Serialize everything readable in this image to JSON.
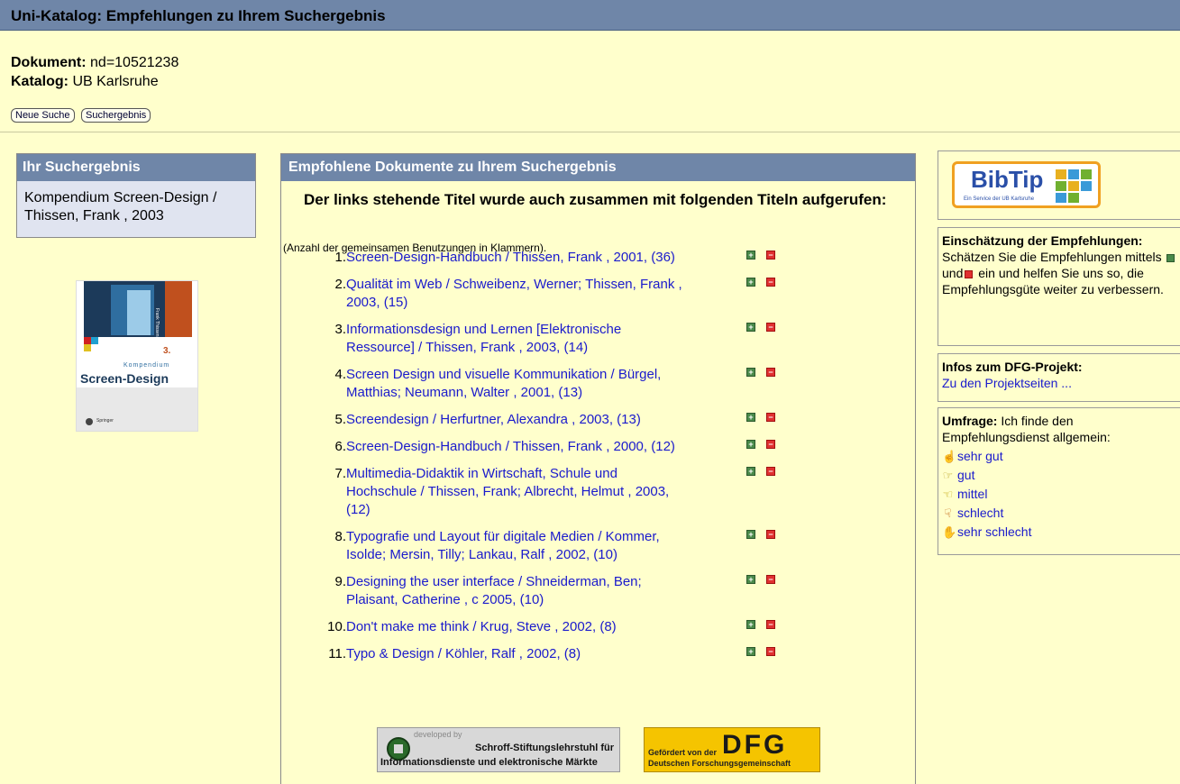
{
  "header": {
    "title": "Uni-Katalog: Empfehlungen zu Ihrem Suchergebnis"
  },
  "doc": {
    "document_label": "Dokument:",
    "document_value": "nd=10521238",
    "catalog_label": "Katalog:",
    "catalog_value": "UB Karlsruhe"
  },
  "buttons": {
    "new_search": "Neue Suche",
    "results": "Suchergebnis"
  },
  "left": {
    "heading": "Ihr Suchergebnis",
    "item_line1": "Kompendium Screen-Design /",
    "item_line2": "Thissen, Frank , 2003",
    "cover": {
      "title": "Screen-Design",
      "edition": "3.",
      "series": "Kompendium",
      "author": "Frank Thissen",
      "publisher": "Springer"
    }
  },
  "middle": {
    "heading": "Empfohlene Dokumente zu Ihrem Suchergebnis",
    "intro": "Der links stehende Titel wurde auch zusammen mit folgenden Titeln aufgerufen:",
    "note": "(Anzahl der gemeinsamen Benutzungen in Klammern).",
    "recommendations": [
      {
        "num": "1.",
        "lines": [
          "Screen-Design-Handbuch / Thissen, Frank , 2001, (36)"
        ]
      },
      {
        "num": "2.",
        "lines": [
          "Qualität im Web / Schweibenz, Werner; Thissen, Frank ,",
          "2003, (15)"
        ]
      },
      {
        "num": "3.",
        "lines": [
          "Informationsdesign und Lernen [Elektronische",
          "Ressource] / Thissen, Frank , 2003, (14)"
        ]
      },
      {
        "num": "4.",
        "lines": [
          "Screen Design und visuelle Kommunikation / Bürgel,",
          "Matthias; Neumann, Walter , 2001, (13)"
        ]
      },
      {
        "num": "5.",
        "lines": [
          "Screendesign / Herfurtner, Alexandra , 2003, (13)"
        ]
      },
      {
        "num": "6.",
        "lines": [
          "Screen-Design-Handbuch / Thissen, Frank , 2000, (12)"
        ]
      },
      {
        "num": "7.",
        "lines": [
          "Multimedia-Didaktik in Wirtschaft, Schule und",
          "Hochschule / Thissen, Frank; Albrecht, Helmut , 2003,",
          "(12)"
        ]
      },
      {
        "num": "8.",
        "lines": [
          "Typografie und Layout für digitale Medien / Kommer,",
          "Isolde; Mersin, Tilly; Lankau, Ralf , 2002, (10)"
        ]
      },
      {
        "num": "9.",
        "lines": [
          "Designing the user interface / Shneiderman, Ben;",
          "Plaisant, Catherine , c 2005, (10)"
        ]
      },
      {
        "num": "10.",
        "lines": [
          "Don't make me think / Krug, Steve , 2002, (8)"
        ]
      },
      {
        "num": "11.",
        "lines": [
          "Typo & Design / Köhler, Ralf , 2002, (8)"
        ]
      }
    ],
    "logos": {
      "developed_by": "developed by",
      "schroff_line1": "Schroff-Stiftungslehrstuhl für",
      "schroff_line2": "Informationsdienste und elektronische Märkte",
      "dfg_line1": "Gefördert von der",
      "dfg_line2": "Deutschen Forschungsgemeinschaft",
      "dfg_logo": "DFG"
    }
  },
  "right": {
    "bibtip": {
      "logo": "BibTip",
      "subtitle": "Ein Service der UB Karlsruhe"
    },
    "rating": {
      "heading": "Einschätzung der Empfehlungen:",
      "text_before": "Schätzen Sie die Empfehlungen mittels",
      "text_and": "und",
      "text_after": "ein und helfen Sie uns so, die Empfehlungsgüte weiter zu verbessern."
    },
    "dfg_project": {
      "heading": "Infos zum DFG-Projekt:",
      "link": "Zu den Projektseiten ..."
    },
    "survey": {
      "heading": "Umfrage:",
      "text": "Ich finde den Empfehlungsdienst allgemein:",
      "options": [
        "sehr gut",
        "gut",
        "mittel",
        "schlecht",
        "sehr schlecht"
      ]
    }
  },
  "colors": {
    "header_bg": "#6f86a8",
    "page_bg": "#ffffcc",
    "link": "#1a1acc",
    "plus": "#4a8a4a",
    "minus": "#e03030"
  }
}
